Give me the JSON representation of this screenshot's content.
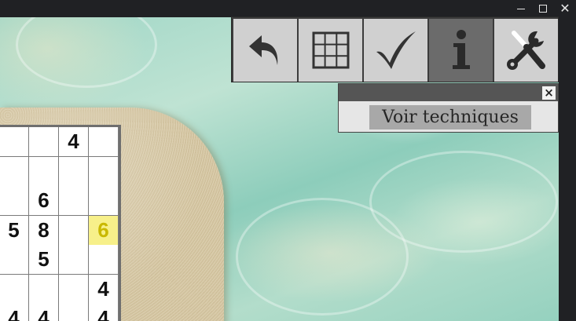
{
  "window": {
    "controls": {
      "minimize_icon": "minimize-icon",
      "maximize_icon": "maximize-icon",
      "close_icon": "close-icon",
      "close_glyph": "✕"
    }
  },
  "toolbar": {
    "buttons": [
      {
        "name": "undo",
        "icon": "undo-arrow-icon",
        "active": false
      },
      {
        "name": "grid",
        "icon": "grid-icon",
        "active": false
      },
      {
        "name": "check",
        "icon": "checkmark-icon",
        "active": false
      },
      {
        "name": "info",
        "icon": "info-icon",
        "active": true
      },
      {
        "name": "tools",
        "icon": "wrench-screwdriver-icon",
        "active": false
      }
    ]
  },
  "panel": {
    "close_glyph": "×",
    "button_label": "Voir techniques"
  },
  "board": {
    "visible_rows": [
      [
        "",
        "",
        "4",
        ""
      ],
      [
        "",
        "",
        "",
        ""
      ],
      [
        "",
        "6",
        "",
        ""
      ],
      [
        "5",
        "8",
        "",
        "6"
      ],
      [
        "",
        "5",
        "",
        ""
      ],
      [
        "",
        "",
        "",
        "4"
      ],
      [
        "4",
        "4",
        "",
        "4"
      ]
    ],
    "highlighted_cell": {
      "row": 3,
      "col": 3
    },
    "colors": {
      "highlight_bg": "#f7f08a",
      "highlight_text": "#c9b800"
    }
  }
}
